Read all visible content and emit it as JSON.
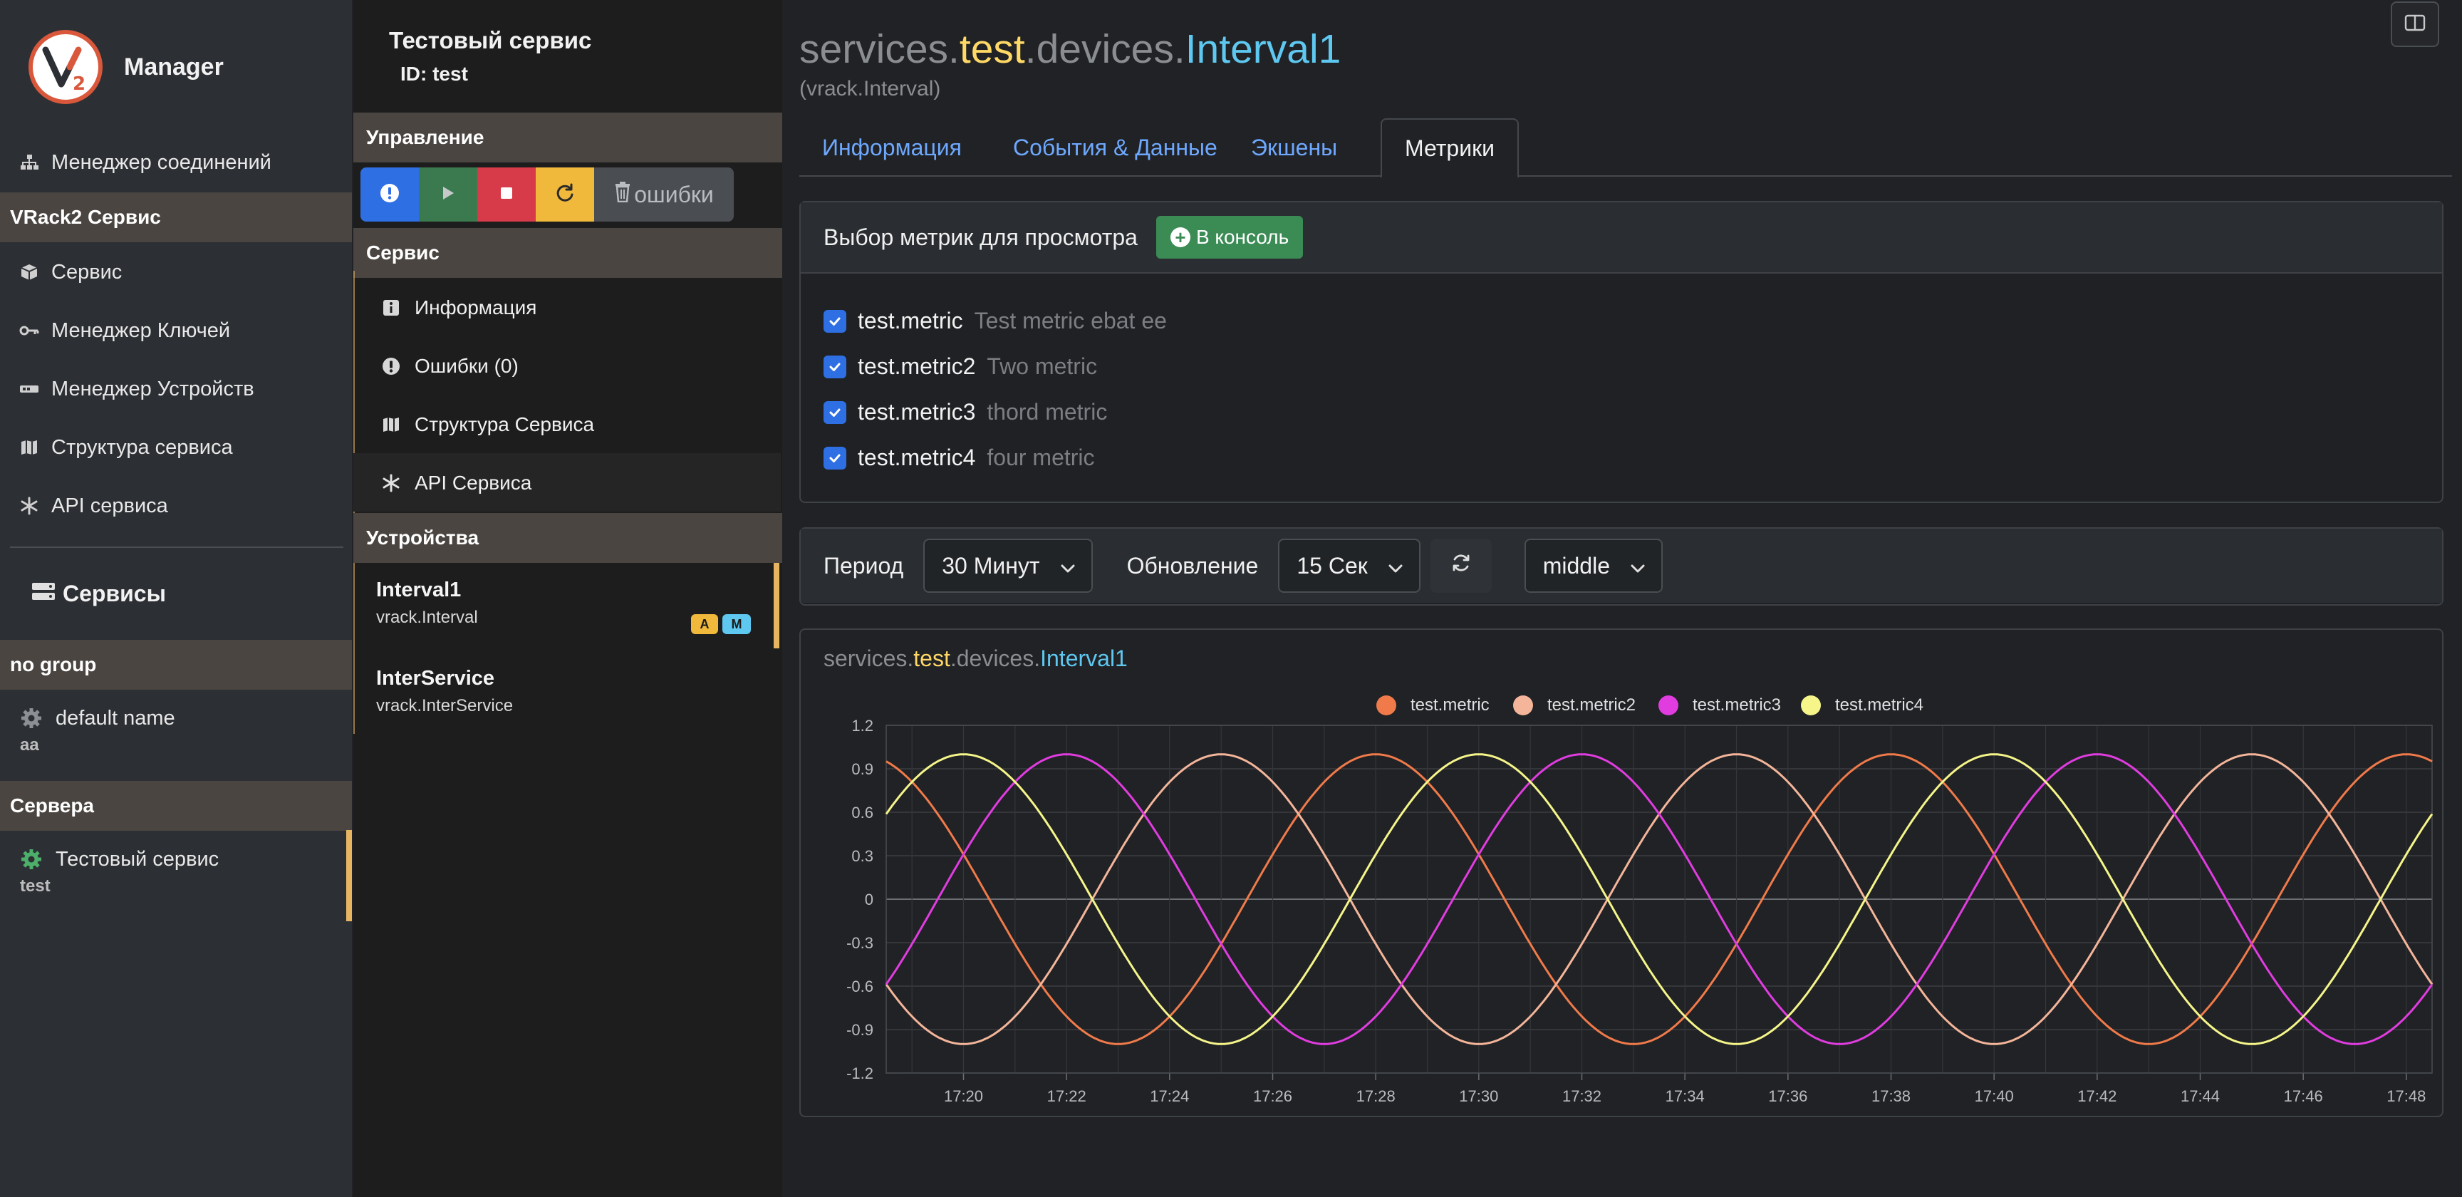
{
  "app": {
    "brand_name": "Manager",
    "logo_text": "V2"
  },
  "sidebar": {
    "top_items": [
      {
        "label": "Менеджер соединений",
        "icon": "sitemap-icon"
      }
    ],
    "vrack_header": "VRack2 Сервис",
    "vrack_items": [
      {
        "label": "Сервис",
        "icon": "cube-icon"
      },
      {
        "label": "Менеджер Ключей",
        "icon": "key-icon"
      },
      {
        "label": "Менеджер Устройств",
        "icon": "device-icon"
      },
      {
        "label": "Структура сервиса",
        "icon": "map-icon"
      },
      {
        "label": "API сервиса",
        "icon": "asterisk-icon"
      }
    ],
    "services_title": "Сервисы",
    "no_group_header": "no group",
    "no_group_item": {
      "name": "default name",
      "sub": "aa"
    },
    "servers_header": "Сервера",
    "servers_item": {
      "name": "Тестовый сервис",
      "sub": "test"
    }
  },
  "midpanel": {
    "service_title": "Тестовый сервис",
    "service_id": "ID: test",
    "control_header": "Управление",
    "errors_button": "ошибки",
    "service_header": "Сервис",
    "service_items": [
      {
        "label": "Информация",
        "icon": "info-icon"
      },
      {
        "label": "Ошибки (0)",
        "icon": "exclamation-icon"
      },
      {
        "label": "Структура Сервиса",
        "icon": "map-icon"
      },
      {
        "label": "API Сервиса",
        "icon": "asterisk-icon"
      }
    ],
    "devices_header": "Устройства",
    "devices": [
      {
        "name": "Interval1",
        "type": "vrack.Interval",
        "badges": [
          "A",
          "M"
        ]
      },
      {
        "name": "InterService",
        "type": "vrack.InterService"
      }
    ]
  },
  "main": {
    "path": [
      "services",
      ".",
      "test",
      ".",
      "devices",
      ".",
      "Interval1"
    ],
    "subtitle": "(vrack.Interval)",
    "tabs": [
      "Информация",
      "События & Данные",
      "Экшены",
      "Метрики"
    ],
    "active_tab": "Метрики",
    "metrics_card": {
      "title": "Выбор метрик для просмотра",
      "console_button": "В консоль",
      "metrics": [
        {
          "name": "test.metric",
          "desc": "Test metric ebat ee",
          "checked": true
        },
        {
          "name": "test.metric2",
          "desc": "Two metric",
          "checked": true
        },
        {
          "name": "test.metric3",
          "desc": "thord metric",
          "checked": true
        },
        {
          "name": "test.metric4",
          "desc": "four metric",
          "checked": true
        }
      ]
    },
    "toolbar": {
      "period_label": "Период",
      "period_value": "30 Минут",
      "update_label": "Обновление",
      "update_value": "15 Сек",
      "mode_value": "middle"
    },
    "chart_title": [
      "services",
      ".",
      "test",
      ".",
      "devices",
      ".",
      "Interval1"
    ]
  },
  "colors": {
    "accent_yellow": "#ffd866",
    "accent_blue": "#5ec8f0",
    "path_grey": "#8a8d91",
    "btn_blue": "#2f6fe4",
    "btn_green": "#3b7a4f",
    "btn_red": "#d73a49",
    "btn_yellow": "#f0b93b"
  },
  "chart_data": {
    "type": "line",
    "title": "",
    "xlabel": "",
    "ylabel": "",
    "x_ticks": [
      "17:20",
      "17:22",
      "17:24",
      "17:26",
      "17:28",
      "17:30",
      "17:32",
      "17:34",
      "17:36",
      "17:38",
      "17:40",
      "17:42",
      "17:44",
      "17:46",
      "17:48"
    ],
    "x_range": [
      "17:18:30",
      "17:48:30"
    ],
    "ylim": [
      -1.2,
      1.2
    ],
    "y_ticks": [
      1.2,
      0.9,
      0.6,
      0.3,
      0,
      -0.3,
      -0.6,
      -0.9,
      -1.2
    ],
    "grid": true,
    "legend_position": "top-center",
    "series": [
      {
        "name": "test.metric",
        "color": "#f07a4a",
        "function": "sine",
        "period_minutes": 10,
        "peaks_at": [
          "17:28",
          "17:38",
          "17:48"
        ],
        "amplitude": 1
      },
      {
        "name": "test.metric2",
        "color": "#f4b59a",
        "function": "sine",
        "period_minutes": 10,
        "peaks_at": [
          "17:25",
          "17:35",
          "17:45"
        ],
        "amplitude": 1
      },
      {
        "name": "test.metric3",
        "color": "#e03ce0",
        "function": "sine",
        "period_minutes": 10,
        "peaks_at": [
          "17:22",
          "17:32",
          "17:42"
        ],
        "amplitude": 1
      },
      {
        "name": "test.metric4",
        "color": "#f5f58a",
        "function": "sine",
        "period_minutes": 10,
        "peaks_at": [
          "17:20",
          "17:30",
          "17:40"
        ],
        "amplitude": 1
      }
    ]
  }
}
